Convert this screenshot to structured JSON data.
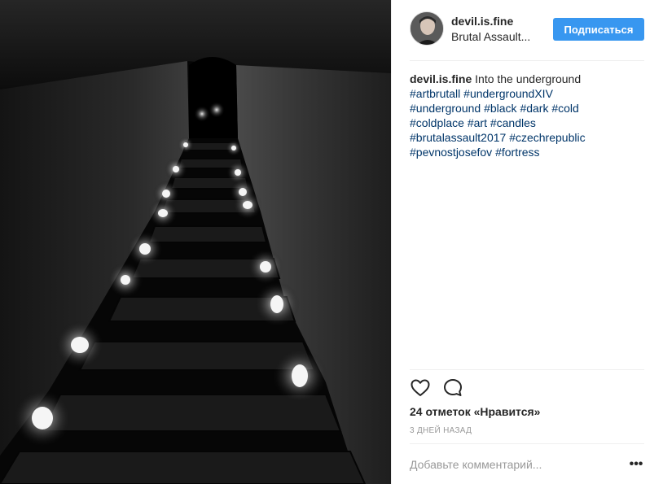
{
  "post": {
    "image_alt": "Dark stone staircase lit by candles descending into a tunnel"
  },
  "header": {
    "username": "devil.is.fine",
    "location": "Brutal Assault...",
    "follow_label": "Подписаться"
  },
  "caption": {
    "author": "devil.is.fine",
    "text": "Into the underground",
    "hashtags": [
      "#artbrutall",
      "#undergroundXIV",
      "#underground",
      "#black",
      "#dark",
      "#cold",
      "#coldplace",
      "#art",
      "#candles",
      "#brutalassault2017",
      "#czechrepublic",
      "#pevnostjosefov",
      "#fortress"
    ]
  },
  "actions": {
    "like_icon": "heart-icon",
    "comment_icon": "comment-icon"
  },
  "likes_text": "24 отметок «Нравится»",
  "timestamp": "3 ДНЕЙ НАЗАД",
  "comment": {
    "placeholder": "Добавьте комментарий...",
    "more_icon": "more-options-icon"
  },
  "colors": {
    "follow_button": "#3897f0",
    "hashtag": "#003569",
    "muted": "#999999"
  }
}
